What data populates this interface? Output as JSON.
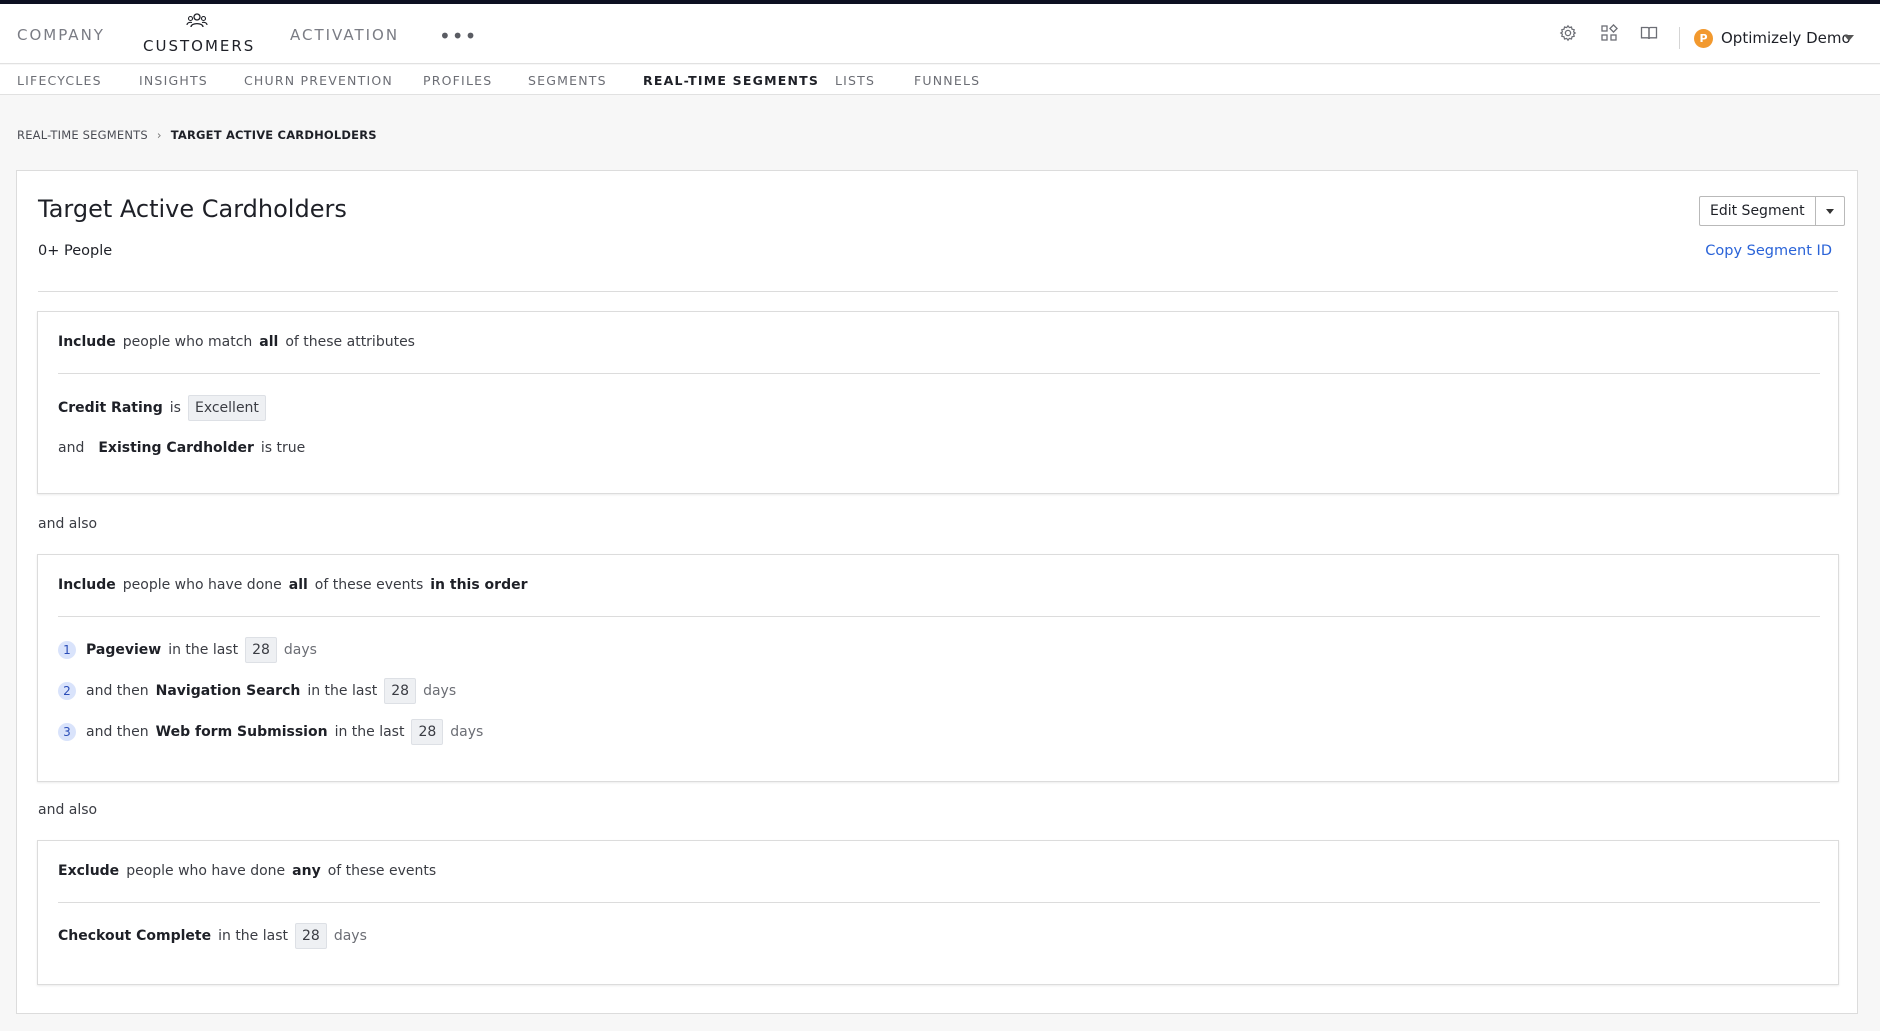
{
  "topnav": {
    "items": [
      "COMPANY",
      "CUSTOMERS",
      "ACTIVATION"
    ],
    "active": "CUSTOMERS",
    "more": "•••",
    "account": {
      "initial": "P",
      "name": "Optimizely Demo"
    }
  },
  "subnav": {
    "items": [
      "LIFECYCLES",
      "INSIGHTS",
      "CHURN PREVENTION",
      "PROFILES",
      "SEGMENTS",
      "REAL-TIME SEGMENTS",
      "LISTS",
      "FUNNELS"
    ],
    "active": "REAL-TIME SEGMENTS"
  },
  "breadcrumb": {
    "parent": "REAL-TIME SEGMENTS",
    "current": "TARGET ACTIVE CARDHOLDERS"
  },
  "segment": {
    "title": "Target Active Cardholders",
    "count": "0+",
    "count_label": "People",
    "edit_label": "Edit Segment",
    "copy_label": "Copy Segment ID"
  },
  "block1": {
    "verb": "Include",
    "pre": "people who match",
    "quant": "all",
    "post": "of these attributes",
    "cond1": {
      "attr": "Credit Rating",
      "op": "is",
      "value": "Excellent"
    },
    "cond2": {
      "conj": "and",
      "attr": "Existing Cardholder",
      "op": "is true"
    }
  },
  "and_also": "and also",
  "block2": {
    "verb": "Include",
    "pre": "people who have done",
    "quant": "all",
    "post": "of these events",
    "order": "in this order",
    "events": [
      {
        "n": "1",
        "conj": "",
        "name": "Pageview",
        "in_last": "in the last",
        "value": "28",
        "unit": "days"
      },
      {
        "n": "2",
        "conj": "and then",
        "name": "Navigation Search",
        "in_last": "in the last",
        "value": "28",
        "unit": "days"
      },
      {
        "n": "3",
        "conj": "and then",
        "name": "Web form Submission",
        "in_last": "in the last",
        "value": "28",
        "unit": "days"
      }
    ]
  },
  "block3": {
    "verb": "Exclude",
    "pre": "people who have done",
    "quant": "any",
    "post": "of these events",
    "event": {
      "name": "Checkout Complete",
      "in_last": "in the last",
      "value": "28",
      "unit": "days"
    }
  },
  "colors": {
    "accent_link": "#2a63d8",
    "avatar": "#f2992e",
    "topline": "#0d1021"
  }
}
